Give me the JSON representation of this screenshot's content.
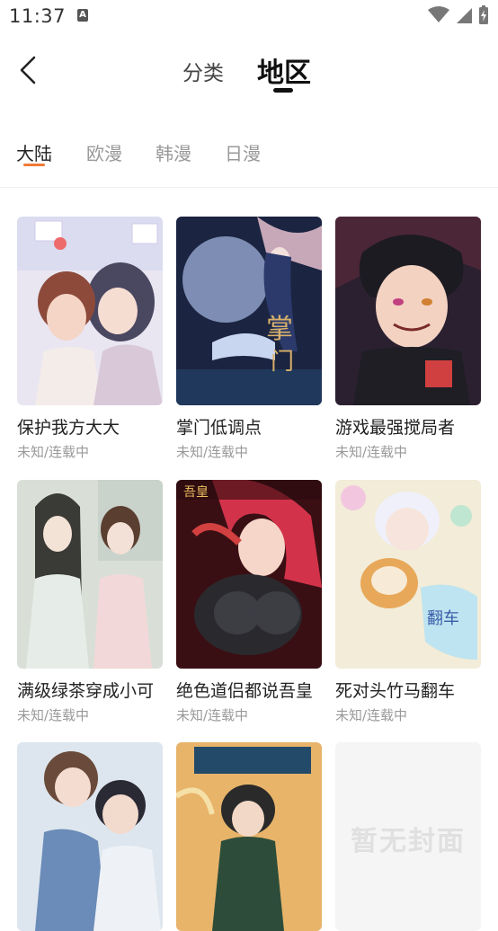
{
  "status_bar": {
    "time": "11:37",
    "notif_icon_letter": "A"
  },
  "header": {
    "tabs": [
      {
        "label": "分类"
      },
      {
        "label": "地区"
      }
    ]
  },
  "sub_tabs": [
    {
      "label": "大陆"
    },
    {
      "label": "欧漫"
    },
    {
      "label": "韩漫"
    },
    {
      "label": "日漫"
    }
  ],
  "comics": [
    {
      "title": "保护我方大大",
      "status": "未知/连载中"
    },
    {
      "title": "掌门低调点",
      "status": "未知/连载中"
    },
    {
      "title": "游戏最强搅局者",
      "status": "未知/连载中"
    },
    {
      "title": "满级绿茶穿成小可",
      "status": "未知/连载中"
    },
    {
      "title": "绝色道侣都说吾皇",
      "status": "未知/连载中"
    },
    {
      "title": "死对头竹马翻车",
      "status": "未知/连载中"
    },
    {
      "cover_text": "暂无封面"
    }
  ],
  "colors": {
    "accent": "#f07a35"
  }
}
